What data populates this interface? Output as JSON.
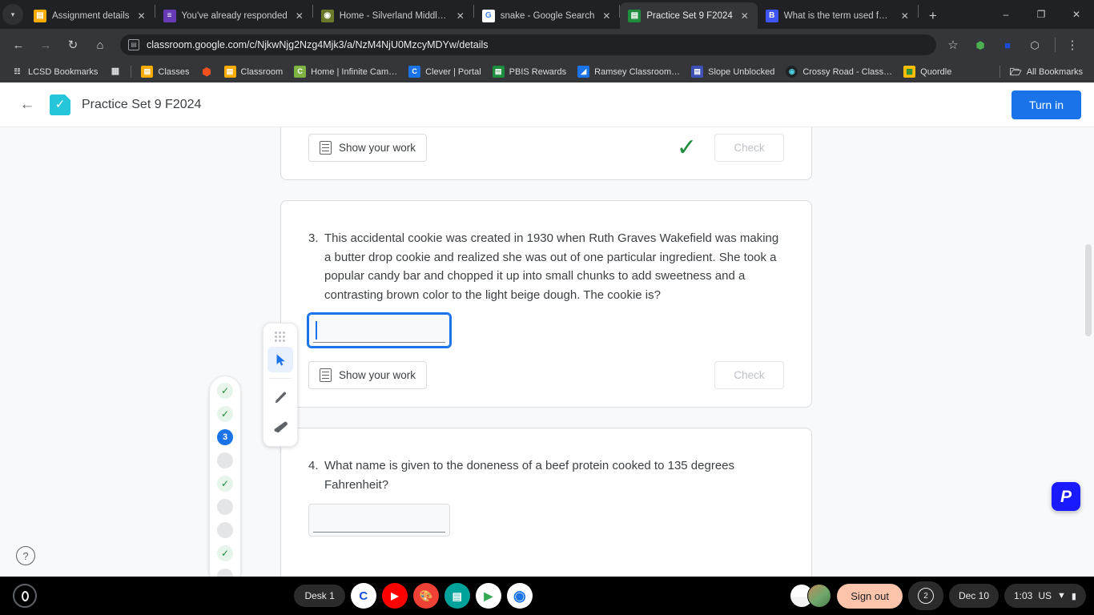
{
  "browser": {
    "tab_search_icon": "chevron-down-icon",
    "tabs": [
      {
        "title": "Assignment details",
        "favicon": "classroom-assignment-icon",
        "favicon_color": "#f9ab00",
        "glyph": "▤",
        "active": false
      },
      {
        "title": "You've already responded",
        "favicon": "google-forms-icon",
        "favicon_color": "#673ab7",
        "glyph": "≡",
        "active": false
      },
      {
        "title": "Home - Silverland Middle S",
        "favicon": "school-seal-icon",
        "favicon_color": "#6b7a2a",
        "glyph": "◎",
        "active": false
      },
      {
        "title": "snake - Google Search",
        "favicon": "google-icon",
        "favicon_color": "#ffffff",
        "glyph": "G",
        "active": false
      },
      {
        "title": "Practice Set 9 F2024",
        "favicon": "classroom-practice-set-icon",
        "favicon_color": "#1e8e3e",
        "glyph": "▤",
        "active": true
      },
      {
        "title": "What is the term used for u",
        "favicon": "brainly-icon",
        "favicon_color": "#4055f5",
        "glyph": "B",
        "active": false
      }
    ],
    "new_tab_label": "+",
    "window_controls": {
      "minimize": "–",
      "maximize": "❐",
      "close": "✕"
    },
    "nav": {
      "back": "←",
      "forward": "→",
      "reload": "↻",
      "home": "⌂"
    },
    "omnibox": {
      "site_icon": "page-info-icon",
      "url": "classroom.google.com/c/NjkwNjg2Nzg4Mjk3/a/NzM4NjU0MzcyMDYw/details"
    },
    "toolbar_right": [
      {
        "name": "bookmark-star-icon",
        "glyph": "☆",
        "color": "#c9cbcf"
      },
      {
        "name": "extension-ck-icon",
        "glyph": "⬢",
        "color": "#4caf50"
      },
      {
        "name": "extension-blue-icon",
        "glyph": "■",
        "color": "#1a4bd8"
      },
      {
        "name": "extensions-puzzle-icon",
        "glyph": "⬡",
        "color": "#c9cbcf"
      },
      {
        "name": "chrome-menu-icon",
        "glyph": "⋮",
        "color": "#c9cbcf"
      }
    ],
    "bookmarks": [
      {
        "label": "LCSD Bookmarks",
        "icon": "folder-settings-icon",
        "color": "transparent",
        "glyph": "❐"
      },
      {
        "label": "",
        "icon": "apps-grid-icon",
        "color": "transparent",
        "glyph": "∷"
      },
      {
        "label": "Classes",
        "icon": "classroom-icon",
        "color": "#f9ab00",
        "glyph": "▤"
      },
      {
        "label": "",
        "icon": "cube-icon",
        "color": "transparent",
        "glyph": "⬢"
      },
      {
        "label": "Classroom",
        "icon": "classroom-icon",
        "color": "#f9ab00",
        "glyph": "▤"
      },
      {
        "label": "Home | Infinite Cam…",
        "icon": "infinite-campus-icon",
        "color": "#7cb342",
        "glyph": "C"
      },
      {
        "label": "Clever | Portal",
        "icon": "clever-icon",
        "color": "#1a73e8",
        "glyph": "C"
      },
      {
        "label": "PBIS Rewards",
        "icon": "pbis-icon",
        "color": "#1e8e3e",
        "glyph": "▤"
      },
      {
        "label": "Ramsey Classroom…",
        "icon": "ramsey-icon",
        "color": "#1a73e8",
        "glyph": "◢"
      },
      {
        "label": "Slope Unblocked",
        "icon": "slope-icon",
        "color": "#3f51b5",
        "glyph": "▤"
      },
      {
        "label": "Crossy Road - Class…",
        "icon": "crossy-road-icon",
        "color": "#202124",
        "glyph": "◉"
      },
      {
        "label": "Quordle",
        "icon": "quordle-icon",
        "color": "#fbbc04",
        "glyph": "▦"
      }
    ],
    "all_bookmarks_label": "All Bookmarks",
    "all_bookmarks_icon": "folder-icon"
  },
  "app": {
    "back_icon": "back-arrow-icon",
    "logo_icon": "practice-set-logo-icon",
    "logo_color": "#25c6da",
    "title": "Practice Set 9 F2024",
    "turn_in_label": "Turn in",
    "accent_color": "#1a73e8",
    "help_icon": "help-question-icon",
    "peardeck_label": "P",
    "peardeck_color": "#1a1aff"
  },
  "progress_rail": {
    "items": [
      {
        "state": "done",
        "label": "✓"
      },
      {
        "state": "done",
        "label": "✓"
      },
      {
        "state": "active",
        "label": "3"
      },
      {
        "state": "todo",
        "label": ""
      },
      {
        "state": "done",
        "label": "✓"
      },
      {
        "state": "todo",
        "label": ""
      },
      {
        "state": "todo",
        "label": ""
      },
      {
        "state": "done",
        "label": "✓"
      },
      {
        "state": "todo",
        "label": ""
      }
    ]
  },
  "tool_palette": {
    "drag_handle_icon": "drag-dots-icon",
    "tools": [
      {
        "name": "cursor-select-tool",
        "icon": "cursor-arrow-icon",
        "selected": true
      },
      {
        "name": "pen-tool",
        "icon": "pen-icon",
        "selected": false
      },
      {
        "name": "eraser-tool",
        "icon": "eraser-icon",
        "selected": false
      }
    ]
  },
  "questions": [
    {
      "number": "",
      "text": "",
      "partial": true,
      "show_work_label": "Show your work",
      "show_work_icon": "document-lines-icon",
      "check_label": "Check",
      "graded_correct": true,
      "correct_mark": "✓"
    },
    {
      "number": "3.",
      "text": "This accidental cookie was created in 1930 when Ruth Graves Wakefield was making a butter drop cookie and realized she was out of one particular ingredient.  She took a popular candy bar and chopped it up into small chunks to add sweetness and a contrasting brown color to the light beige dough.  The cookie is?",
      "answer_value": "",
      "answer_focused": true,
      "show_work_label": "Show your work",
      "show_work_icon": "document-lines-icon",
      "check_label": "Check",
      "graded_correct": false
    },
    {
      "number": "4.",
      "text": "What name is given to the doneness of a beef protein cooked to 135 degrees Fahrenheit?",
      "answer_value": "",
      "answer_focused": false
    }
  ],
  "shelf": {
    "launcher_icon": "chromeos-launcher-icon",
    "desk_label": "Desk 1",
    "apps": [
      {
        "name": "clever-app",
        "glyph": "C",
        "bg": "#ffffff",
        "fg": "#1a4bd8",
        "running": false
      },
      {
        "name": "youtube-app",
        "glyph": "▶",
        "bg": "#ff0000",
        "fg": "#ffffff",
        "running": false
      },
      {
        "name": "gartic-app",
        "glyph": "✐",
        "bg": "#ef4136",
        "fg": "#ffffff",
        "running": false
      },
      {
        "name": "google-slides-app",
        "glyph": "▤",
        "bg": "#00a39b",
        "fg": "#ffffff",
        "running": false
      },
      {
        "name": "play-store-app",
        "glyph": "▶",
        "bg": "#ffffff",
        "fg": "#34a853",
        "running": false
      },
      {
        "name": "chrome-app",
        "glyph": "◉",
        "bg": "#ffffff",
        "fg": "#1a73e8",
        "running": true
      }
    ],
    "sign_out_label": "Sign out",
    "notification_count": "2",
    "date": "Dec 10",
    "time": "1:03",
    "keyboard_layout": "US",
    "wifi_icon": "wifi-icon",
    "battery_icon": "battery-icon"
  }
}
